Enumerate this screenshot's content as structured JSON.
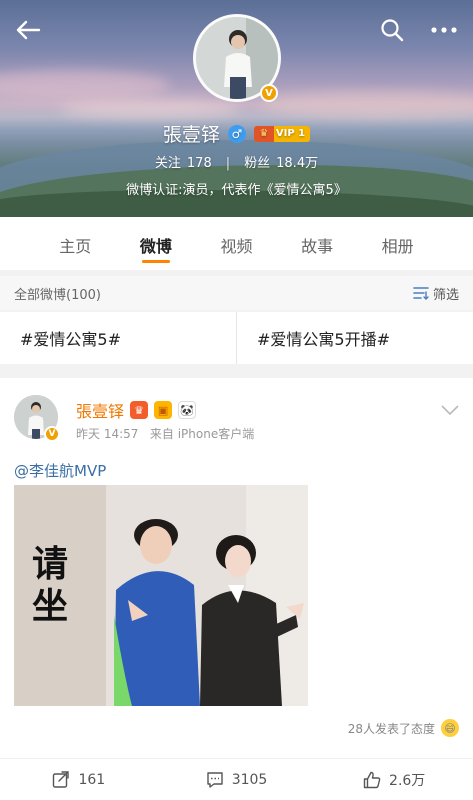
{
  "topbar": {
    "back_icon": "arrow-left-icon",
    "search_icon": "search-icon",
    "more_icon": "more-dots-icon"
  },
  "profile": {
    "name": "張壹铎",
    "gender": "♂",
    "vip_label": "VIP 1",
    "follow_label": "关注",
    "follow_count": "178",
    "fans_label": "粉丝",
    "fans_count": "18.4万",
    "certification": "微博认证:演员，代表作《爱情公寓5》"
  },
  "tabs": [
    {
      "label": "主页",
      "active": false
    },
    {
      "label": "微博",
      "active": true
    },
    {
      "label": "视频",
      "active": false
    },
    {
      "label": "故事",
      "active": false
    },
    {
      "label": "相册",
      "active": false
    }
  ],
  "filter": {
    "all_label": "全部微博(100)",
    "filter_label": "筛选"
  },
  "topics": [
    "#爱情公寓5#",
    "#爱情公寓5开播#"
  ],
  "post": {
    "author": "張壹铎",
    "time": "昨天 14:57",
    "source_prefix": "来自",
    "source": "iPhone客户端",
    "text": "@李佳航MVP",
    "image_caption": "请坐",
    "attitude_text": "28人发表了态度",
    "reposts": "161",
    "comments": "3105",
    "likes": "2.6万"
  },
  "colors": {
    "accent": "#ff8200",
    "name_orange": "#f07800",
    "link_blue": "#3a6ea5"
  }
}
